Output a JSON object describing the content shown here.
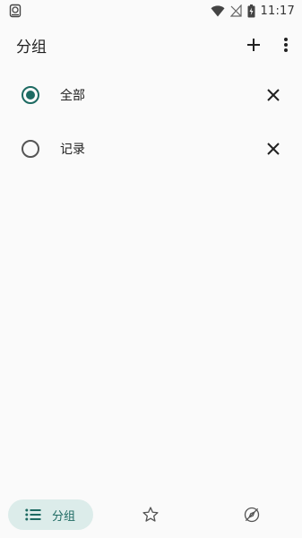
{
  "status_bar": {
    "time": "11:17",
    "icons": [
      "storage-icon",
      "wifi-icon",
      "no-signal-icon",
      "battery-charging-icon"
    ]
  },
  "app_bar": {
    "title": "分组",
    "actions": [
      "add-icon",
      "more-vert-icon"
    ]
  },
  "groups": [
    {
      "label": "全部",
      "selected": true
    },
    {
      "label": "记录",
      "selected": false
    }
  ],
  "bottom_nav": {
    "active_label": "分组",
    "items": [
      "list-icon",
      "star-icon",
      "explore-off-icon"
    ]
  },
  "colors": {
    "accent": "#1d6a62",
    "nav_pill": "#dcecea",
    "background": "#fafafa"
  }
}
